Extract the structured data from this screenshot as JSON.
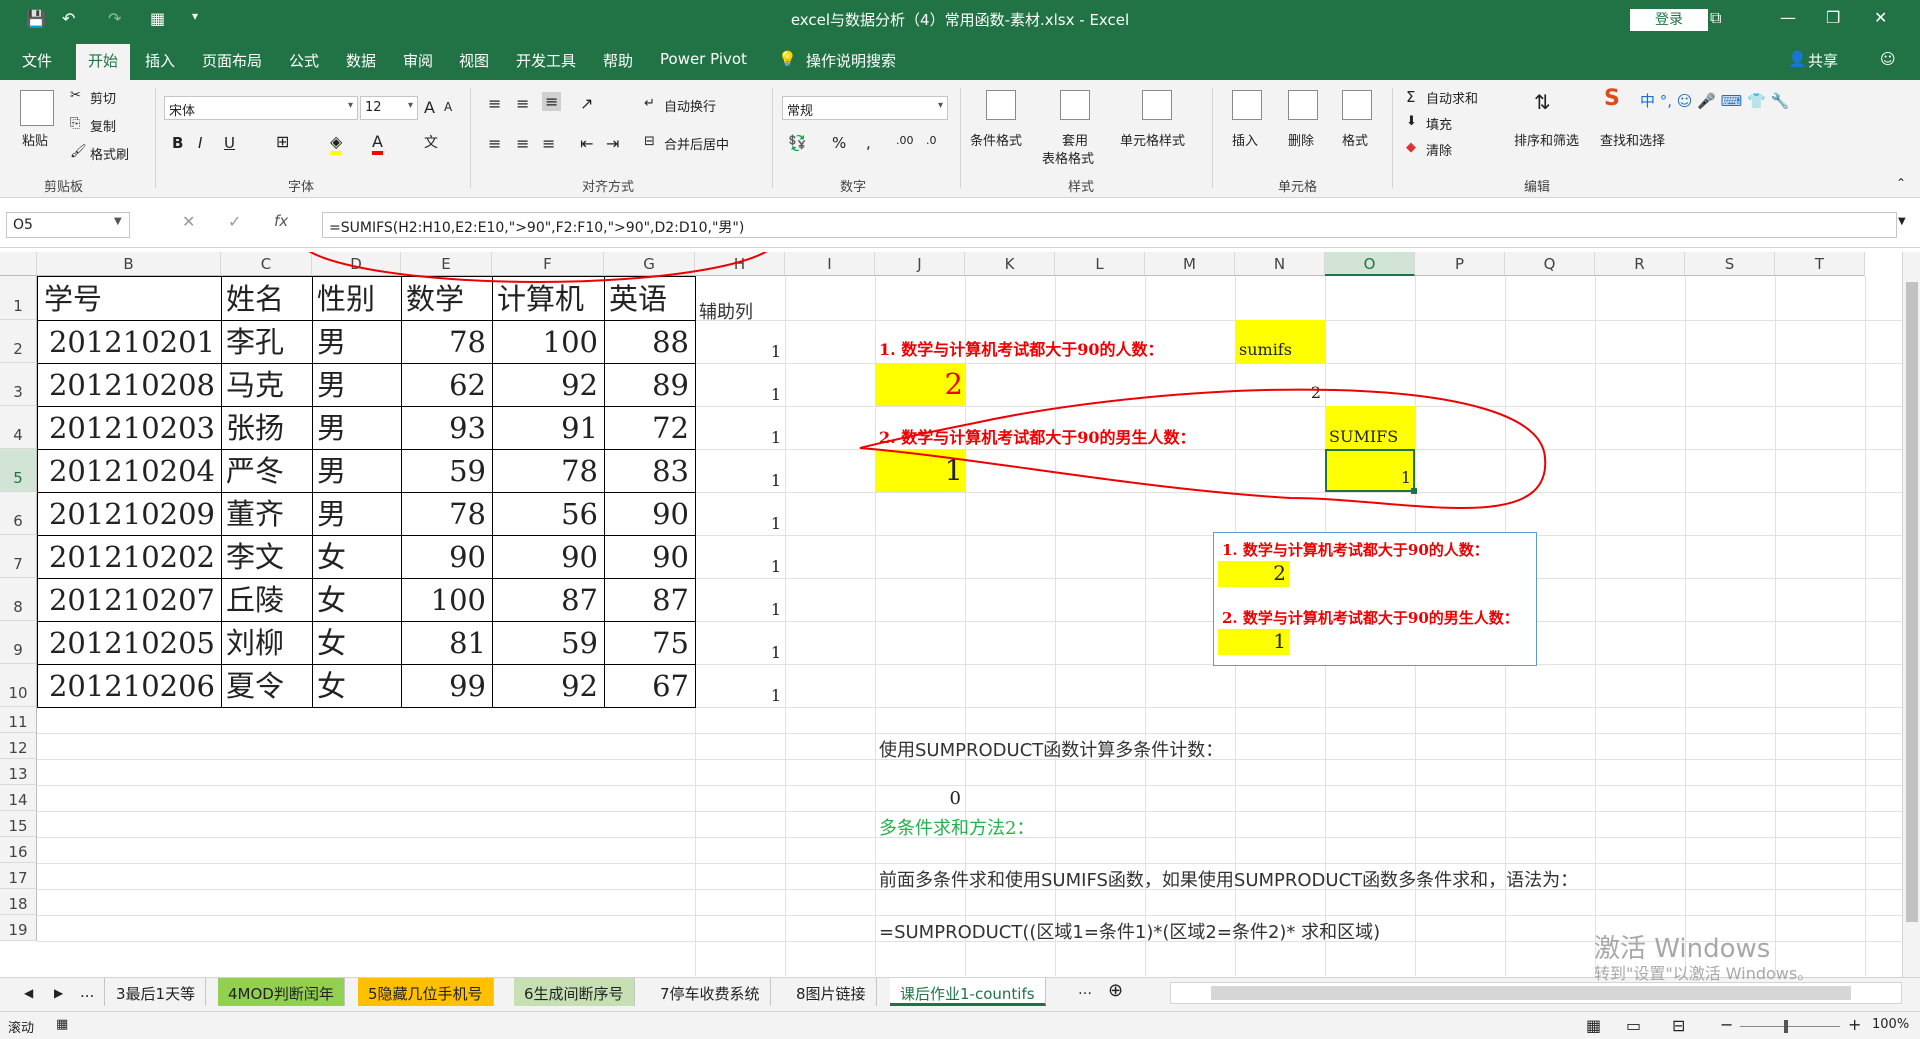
{
  "titlebar": {
    "title": "excel与数据分析（4）常用函数-素材.xlsx - Excel",
    "login": "登录"
  },
  "tabs": [
    "文件",
    "开始",
    "插入",
    "页面布局",
    "公式",
    "数据",
    "审阅",
    "视图",
    "开发工具",
    "帮助",
    "Power Pivot",
    "操作说明搜索"
  ],
  "share": "共享",
  "ribbon": {
    "clipboard": {
      "paste": "粘贴",
      "cut": "剪切",
      "copy": "复制",
      "format_painter": "格式刷",
      "label": "剪贴板"
    },
    "font": {
      "name": "宋体",
      "size": "12",
      "bold": "B",
      "italic": "I",
      "underline": "U",
      "grow": "A",
      "shrink": "A",
      "label": "字体"
    },
    "align": {
      "wrap": "自动换行",
      "merge": "合并后居中",
      "label": "对齐方式"
    },
    "number": {
      "format": "常规",
      "percent": "%",
      "comma": ",",
      "label": "数字"
    },
    "styles": {
      "cond": "条件格式",
      "table1": "套用",
      "table2": "表格格式",
      "cell": "单元格样式",
      "label": "样式"
    },
    "cells": {
      "insert": "插入",
      "delete": "删除",
      "format": "格式",
      "label": "单元格"
    },
    "edit": {
      "autosum": "自动求和",
      "fill": "填充",
      "clear": "清除",
      "sort": "排序和筛选",
      "find": "查找和选择",
      "label": "编辑"
    }
  },
  "formula_bar": {
    "namebox": "O5",
    "formula": "=SUMIFS(H2:H10,E2:E10,\">90\",F2:F10,\">90\",D2:D10,\"男\")"
  },
  "columns": [
    "B",
    "C",
    "D",
    "E",
    "F",
    "G",
    "H",
    "I",
    "J",
    "K",
    "L",
    "M",
    "N",
    "O",
    "P",
    "Q",
    "R",
    "S",
    "T"
  ],
  "rows": [
    "1",
    "2",
    "3",
    "4",
    "5",
    "6",
    "7",
    "8",
    "9",
    "10",
    "11",
    "12",
    "13",
    "14",
    "15",
    "16",
    "17",
    "18",
    "19"
  ],
  "table": {
    "headers": [
      "学号",
      "姓名",
      "性别",
      "数学",
      "计算机",
      "英语"
    ],
    "helper": "辅助列",
    "rows": [
      [
        "201210201",
        "李孔",
        "男",
        "78",
        "100",
        "88",
        "1"
      ],
      [
        "201210208",
        "马克",
        "男",
        "62",
        "92",
        "89",
        "1"
      ],
      [
        "201210203",
        "张扬",
        "男",
        "93",
        "91",
        "72",
        "1"
      ],
      [
        "201210204",
        "严冬",
        "男",
        "59",
        "78",
        "83",
        "1"
      ],
      [
        "201210209",
        "董齐",
        "男",
        "78",
        "56",
        "90",
        "1"
      ],
      [
        "201210202",
        "李文",
        "女",
        "90",
        "90",
        "90",
        "1"
      ],
      [
        "201210207",
        "丘陵",
        "女",
        "100",
        "87",
        "87",
        "1"
      ],
      [
        "201210205",
        "刘柳",
        "女",
        "81",
        "59",
        "75",
        "1"
      ],
      [
        "201210206",
        "夏令",
        "女",
        "99",
        "92",
        "67",
        "1"
      ]
    ]
  },
  "notes": {
    "q1": "1. 数学与计算机考试都大于90的人数：",
    "q1_fn": "sumifs",
    "q1_ans": "2",
    "q1_n3": "2",
    "q2": "2. 数学与计算机考试都大于90的男生人数：",
    "q2_fn": "SUMIFS",
    "q2_ans": "1",
    "q2_o5": "1",
    "box_q1": "1. 数学与计算机考试都大于90的人数：",
    "box_a1": "2",
    "box_q2": "2. 数学与计算机考试都大于90的男生人数：",
    "box_a2": "1",
    "r12": "使用SUMPRODUCT函数计算多条件计数：",
    "r14": "0",
    "r15": "多条件求和方法2：",
    "r17": "前面多条件求和使用SUMIFS函数，如果使用SUMPRODUCT函数多条件求和，语法为：",
    "r19": "=SUMPRODUCT((区域1=条件1)*(区域2=条件2)* 求和区域)"
  },
  "sheet_tabs": [
    "...",
    "3最后1天等",
    "4MOD判断闰年",
    "5隐藏几位手机号",
    "6生成间断序号",
    "7停车收费系统",
    "8图片链接",
    "课后作业1-countifs"
  ],
  "sheet_tab_colors": {
    "4MOD判断闰年": "#92d050",
    "5隐藏几位手机号": "#ffc000",
    "6生成间断序号": "#c6e0b4"
  },
  "status": {
    "mode": "滚动",
    "zoom": "100%"
  },
  "watermark": {
    "line1": "激活 Windows",
    "line2": "转到\"设置\"以激活 Windows。"
  }
}
